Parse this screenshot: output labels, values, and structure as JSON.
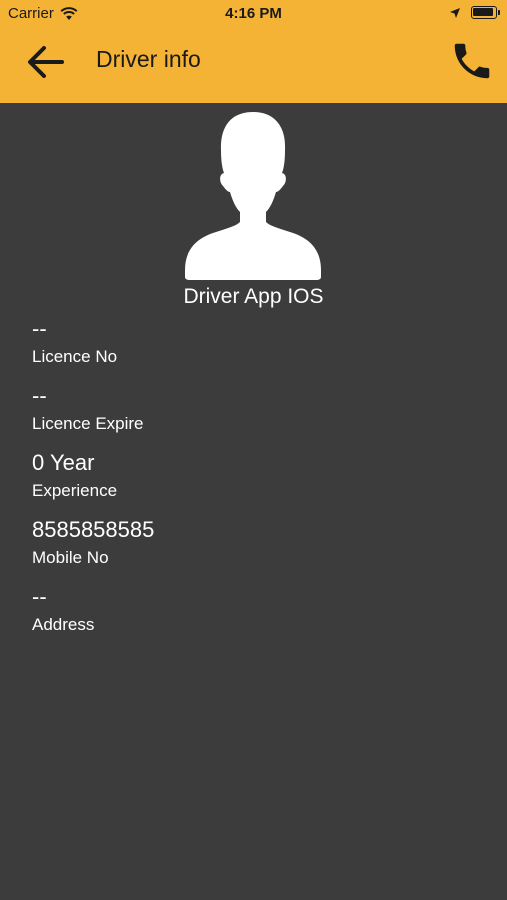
{
  "status_bar": {
    "carrier": "Carrier",
    "time": "4:16 PM"
  },
  "nav": {
    "title": "Driver info",
    "back_icon": "arrow-left-icon",
    "call_icon": "phone-icon"
  },
  "profile": {
    "avatar_icon": "person-silhouette-icon",
    "name": "Driver App IOS"
  },
  "fields": [
    {
      "value": "--",
      "label": "Licence No"
    },
    {
      "value": "--",
      "label": "Licence Expire"
    },
    {
      "value": "0 Year",
      "label": "Experience"
    },
    {
      "value": "8585858585",
      "label": "Mobile No"
    },
    {
      "value": "--",
      "label": "Address"
    }
  ],
  "colors": {
    "header": "#f4b334",
    "background": "#3c3c3c",
    "text": "#ffffff",
    "header_text": "#1a1a1a"
  }
}
